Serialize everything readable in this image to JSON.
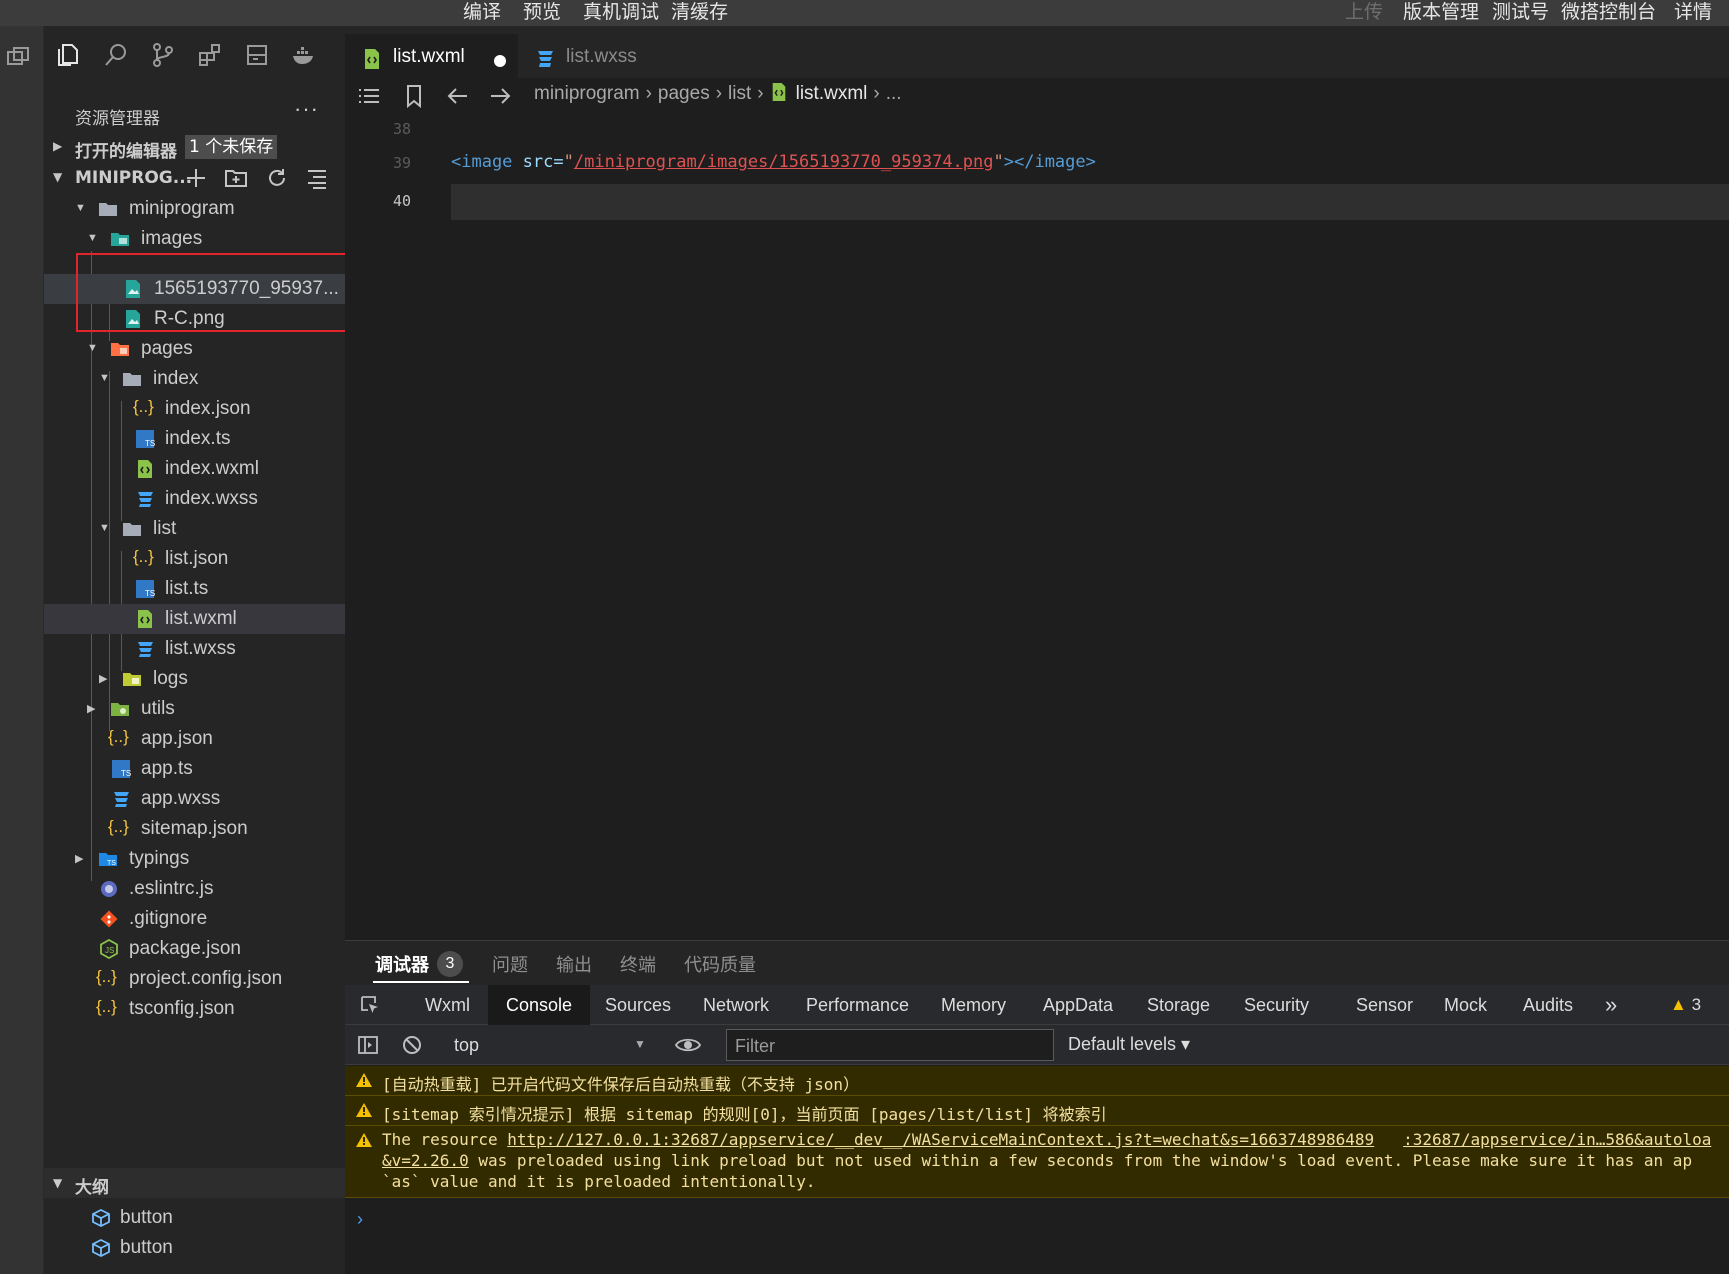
{
  "menubar": {
    "items": [
      "编译",
      "预览",
      "真机调试",
      "清缓存"
    ],
    "right_disabled": "上传",
    "right_items": [
      "版本管理",
      "测试号",
      "微搭控制台",
      "详情"
    ]
  },
  "explorer": {
    "title": "资源管理器",
    "more": "···",
    "open_editors": {
      "label": "打开的编辑器",
      "badge": "1 个未保存"
    },
    "project": {
      "label": "MINIPROG..."
    }
  },
  "tree": [
    {
      "label": "miniprogram",
      "kind": "folder"
    },
    {
      "label": "images",
      "kind": "folder-img"
    },
    {
      "label": "1565193770_95937...",
      "kind": "image"
    },
    {
      "label": "R-C.png",
      "kind": "image"
    },
    {
      "label": "pages",
      "kind": "folder-pages"
    },
    {
      "label": "index",
      "kind": "folder"
    },
    {
      "label": "index.json",
      "kind": "json"
    },
    {
      "label": "index.ts",
      "kind": "ts"
    },
    {
      "label": "index.wxml",
      "kind": "wxml"
    },
    {
      "label": "index.wxss",
      "kind": "wxss"
    },
    {
      "label": "list",
      "kind": "folder"
    },
    {
      "label": "list.json",
      "kind": "json"
    },
    {
      "label": "list.ts",
      "kind": "ts"
    },
    {
      "label": "list.wxml",
      "kind": "wxml"
    },
    {
      "label": "list.wxss",
      "kind": "wxss"
    },
    {
      "label": "logs",
      "kind": "folder-green"
    },
    {
      "label": "utils",
      "kind": "folder-green"
    },
    {
      "label": "app.json",
      "kind": "json"
    },
    {
      "label": "app.ts",
      "kind": "ts"
    },
    {
      "label": "app.wxss",
      "kind": "wxss"
    },
    {
      "label": "sitemap.json",
      "kind": "json"
    },
    {
      "label": "typings",
      "kind": "folder-ts"
    },
    {
      "label": ".eslintrc.js",
      "kind": "eslint"
    },
    {
      "label": ".gitignore",
      "kind": "git"
    },
    {
      "label": "package.json",
      "kind": "npm"
    },
    {
      "label": "project.config.json",
      "kind": "json"
    },
    {
      "label": "tsconfig.json",
      "kind": "json"
    }
  ],
  "outline": {
    "title": "大纲",
    "items": [
      "button",
      "button"
    ]
  },
  "tabs": [
    {
      "label": "list.wxml",
      "icon": "wxml-file-icon"
    },
    {
      "label": "list.wxss",
      "icon": "wxss-file-icon"
    }
  ],
  "breadcrumb": [
    "miniprogram",
    "pages",
    "list",
    "list.wxml",
    "..."
  ],
  "editor": {
    "line_numbers": [
      "38",
      "39",
      "40"
    ],
    "code": {
      "open_tag": "<image",
      "attr": " src=",
      "q1": "\"",
      "src": "/miniprogram/images/1565193770_959374.png",
      "q2": "\"",
      "close": "></image>"
    }
  },
  "panel": {
    "tabs": [
      "调试器",
      "问题",
      "输出",
      "终端",
      "代码质量"
    ],
    "debugger_badge": "3",
    "devtools_tabs": [
      "Wxml",
      "Console",
      "Sources",
      "Network",
      "Performance",
      "Memory",
      "AppData",
      "Storage",
      "Security",
      "Sensor",
      "Mock",
      "Audits"
    ],
    "more_tabs": "»",
    "warning_count": "3",
    "context": "top",
    "filter_placeholder": "Filter",
    "levels": "Default levels ▾",
    "logs": {
      "l1": "[自动热重载] 已开启代码文件保存后自动热重载（不支持 json）",
      "l2": "[sitemap 索引情况提示] 根据 sitemap 的规则[0]，当前页面 [pages/list/list] 将被索引",
      "l3_prefix": "The resource ",
      "l3_link": "http://127.0.0.1:32687/appservice/__dev__/WAServiceMainContext.js?t=wechat&s=1663748986489",
      "l3_link2": ":32687/appservice/in…586&autoloa",
      "l3_link3": "&v=2.26.0",
      "l3_mid": " was preloaded using link preload but not used within a few seconds from the window's load event. Please make sure it has an ap",
      "l3_end": "`as` value and it is preloaded intentionally."
    },
    "prompt": "›"
  },
  "colors": {
    "accent_warning": "#f5c000",
    "highlight_box": "#e0262c",
    "wxml_icon": "#8bc34a",
    "wxss_icon": "#42a5f5",
    "json_icon": "#f5c542",
    "ts_icon": "#3178c6"
  }
}
